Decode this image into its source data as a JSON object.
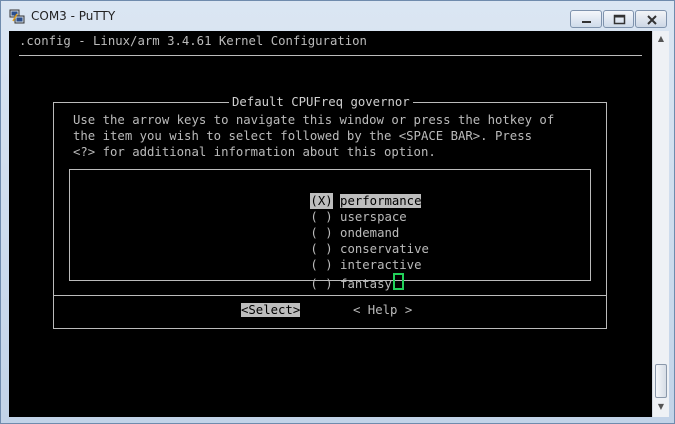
{
  "window": {
    "title": "COM3 - PuTTY"
  },
  "terminal": {
    "header": ".config - Linux/arm 3.4.61 Kernel Configuration",
    "dialog": {
      "title": "Default CPUFreq governor",
      "help_lines": [
        "Use the arrow keys to navigate this window or press the hotkey of",
        "the item you wish to select followed by the <SPACE BAR>. Press",
        "<?> for additional information about this option."
      ],
      "options": [
        {
          "mark": "(X)",
          "label": "performance",
          "selected": true
        },
        {
          "mark": "( )",
          "label": "userspace",
          "selected": false
        },
        {
          "mark": "( )",
          "label": "ondemand",
          "selected": false
        },
        {
          "mark": "( )",
          "label": "conservative",
          "selected": false
        },
        {
          "mark": "( )",
          "label": "interactive",
          "selected": false
        },
        {
          "mark": "( )",
          "label": "fantasy",
          "selected": false
        }
      ],
      "select_button": "<Select>",
      "help_button": "< Help >"
    }
  },
  "colors": {
    "terminal_bg": "#000000",
    "text": "#bbbbbb",
    "cursor": "#22d15a",
    "highlight": "#bdbdbd"
  }
}
